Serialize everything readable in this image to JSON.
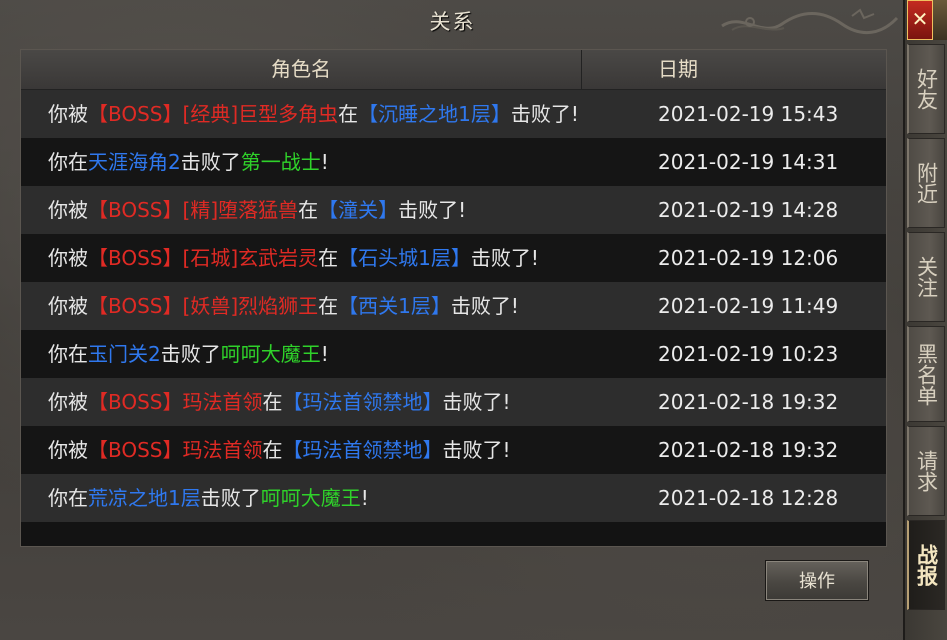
{
  "window": {
    "title": "关系"
  },
  "table": {
    "col_name": "角色名",
    "col_date": "日期",
    "rows": [
      {
        "parts": [
          {
            "t": "你被",
            "c": ""
          },
          {
            "t": "【BOSS】",
            "c": "red"
          },
          {
            "t": "[经典]巨型多角虫",
            "c": "red"
          },
          {
            "t": "在",
            "c": ""
          },
          {
            "t": "【沉睡之地1层】",
            "c": "blue"
          },
          {
            "t": "击败了!",
            "c": ""
          }
        ],
        "date": "2021-02-19 15:43"
      },
      {
        "parts": [
          {
            "t": "你在",
            "c": ""
          },
          {
            "t": "天涯海角2",
            "c": "blue"
          },
          {
            "t": "击败了",
            "c": ""
          },
          {
            "t": "第一战士",
            "c": "green"
          },
          {
            "t": "!",
            "c": ""
          }
        ],
        "date": "2021-02-19 14:31"
      },
      {
        "parts": [
          {
            "t": "你被",
            "c": ""
          },
          {
            "t": "【BOSS】",
            "c": "red"
          },
          {
            "t": "[精]堕落猛兽",
            "c": "red"
          },
          {
            "t": "在",
            "c": ""
          },
          {
            "t": "【潼关】",
            "c": "blue"
          },
          {
            "t": "击败了!",
            "c": ""
          }
        ],
        "date": "2021-02-19 14:28"
      },
      {
        "parts": [
          {
            "t": "你被",
            "c": ""
          },
          {
            "t": "【BOSS】",
            "c": "red"
          },
          {
            "t": "[石城]玄武岩灵",
            "c": "red"
          },
          {
            "t": "在",
            "c": ""
          },
          {
            "t": "【石头城1层】",
            "c": "blue"
          },
          {
            "t": "击败了!",
            "c": ""
          }
        ],
        "date": "2021-02-19 12:06"
      },
      {
        "parts": [
          {
            "t": "你被",
            "c": ""
          },
          {
            "t": "【BOSS】",
            "c": "red"
          },
          {
            "t": "[妖兽]烈焰狮王",
            "c": "red"
          },
          {
            "t": "在",
            "c": ""
          },
          {
            "t": "【西关1层】",
            "c": "blue"
          },
          {
            "t": "击败了!",
            "c": ""
          }
        ],
        "date": "2021-02-19 11:49"
      },
      {
        "parts": [
          {
            "t": "你在",
            "c": ""
          },
          {
            "t": "玉门关2",
            "c": "blue"
          },
          {
            "t": "击败了",
            "c": ""
          },
          {
            "t": "呵呵大魔王",
            "c": "green"
          },
          {
            "t": "!",
            "c": ""
          }
        ],
        "date": "2021-02-19 10:23"
      },
      {
        "parts": [
          {
            "t": "你被",
            "c": ""
          },
          {
            "t": "【BOSS】",
            "c": "red"
          },
          {
            "t": "玛法首领",
            "c": "red"
          },
          {
            "t": "在",
            "c": ""
          },
          {
            "t": "【玛法首领禁地】",
            "c": "blue"
          },
          {
            "t": "击败了!",
            "c": ""
          }
        ],
        "date": "2021-02-18 19:32"
      },
      {
        "parts": [
          {
            "t": "你被",
            "c": ""
          },
          {
            "t": "【BOSS】",
            "c": "red"
          },
          {
            "t": "玛法首领",
            "c": "red"
          },
          {
            "t": "在",
            "c": ""
          },
          {
            "t": "【玛法首领禁地】",
            "c": "blue"
          },
          {
            "t": "击败了!",
            "c": ""
          }
        ],
        "date": "2021-02-18 19:32"
      },
      {
        "parts": [
          {
            "t": "你在",
            "c": ""
          },
          {
            "t": "荒凉之地1层",
            "c": "blue"
          },
          {
            "t": "击败了",
            "c": ""
          },
          {
            "t": "呵呵大魔王",
            "c": "green"
          },
          {
            "t": "!",
            "c": ""
          }
        ],
        "date": "2021-02-18 12:28"
      }
    ]
  },
  "buttons": {
    "action": "操作",
    "close": "✕"
  },
  "tabs": [
    {
      "label": "好友",
      "name": "tab-friends",
      "active": false
    },
    {
      "label": "附近",
      "name": "tab-nearby",
      "active": false
    },
    {
      "label": "关注",
      "name": "tab-follow",
      "active": false
    },
    {
      "label": "黑名单",
      "name": "tab-blacklist",
      "active": false
    },
    {
      "label": "请求",
      "name": "tab-requests",
      "active": false
    },
    {
      "label": "战报",
      "name": "tab-battle-report",
      "active": true
    }
  ],
  "colors": {
    "red": "#e02a24",
    "blue": "#2f78ee",
    "green": "#2fd22a"
  }
}
